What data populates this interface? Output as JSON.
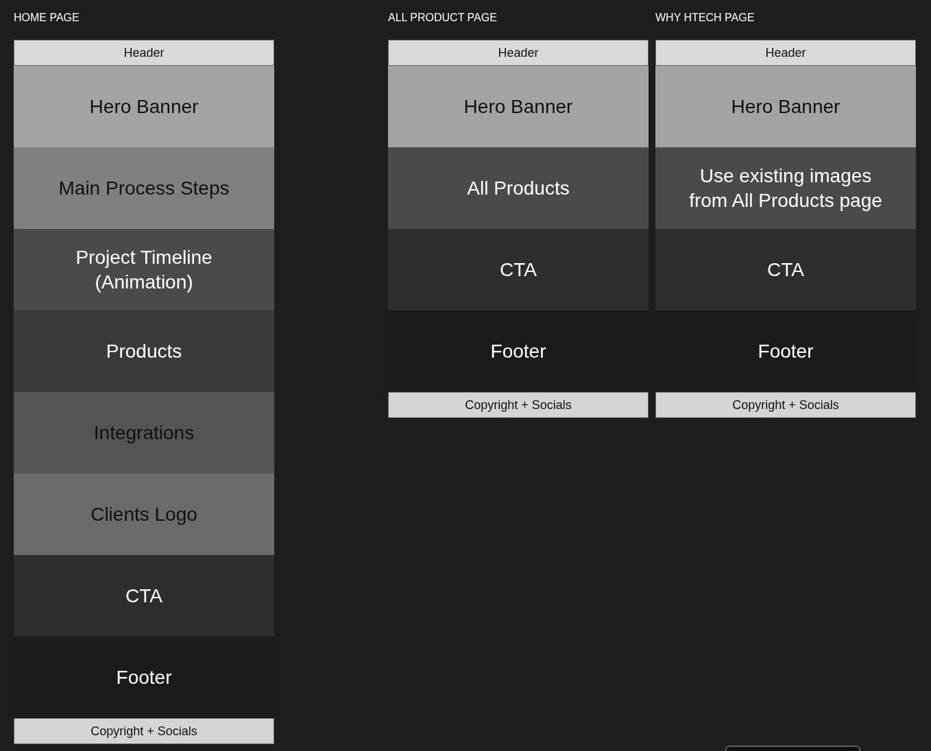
{
  "pages": [
    {
      "title": "HOME PAGE",
      "sections": [
        {
          "label": "Header",
          "kind": "bar",
          "color": "#d9d9d9",
          "dark_label": true
        },
        {
          "label": "Hero Banner",
          "kind": "block",
          "color": "#a3a3a3",
          "dark_label": true
        },
        {
          "label": "Main Process Steps",
          "kind": "block",
          "color": "#808080",
          "dark_label": true
        },
        {
          "label": "Project Timeline (Animation)",
          "kind": "block",
          "color": "#4a4a4a",
          "dark_label": false
        },
        {
          "label": "Products",
          "kind": "block",
          "color": "#3a3a3a",
          "dark_label": false
        },
        {
          "label": "Integrations",
          "kind": "block",
          "color": "#555555",
          "dark_label": true
        },
        {
          "label": "Clients Logo",
          "kind": "block",
          "color": "#6b6b6b",
          "dark_label": true
        },
        {
          "label": "CTA",
          "kind": "block",
          "color": "#2e2e2e",
          "dark_label": false
        },
        {
          "label": "Footer",
          "kind": "block",
          "color": "#1b1b1b",
          "dark_label": false
        },
        {
          "label": "Copyright + Socials",
          "kind": "bar",
          "color": "#d4d4d4",
          "dark_label": true
        }
      ]
    },
    {
      "title": "ALL PRODUCT PAGE",
      "sections": [
        {
          "label": "Header",
          "kind": "bar",
          "color": "#d9d9d9",
          "dark_label": true
        },
        {
          "label": "Hero Banner",
          "kind": "block",
          "color": "#a3a3a3",
          "dark_label": true
        },
        {
          "label": "All Products",
          "kind": "block",
          "color": "#4a4a4a",
          "dark_label": false
        },
        {
          "label": "CTA",
          "kind": "block",
          "color": "#2e2e2e",
          "dark_label": false
        },
        {
          "label": "Footer",
          "kind": "block",
          "color": "#1b1b1b",
          "dark_label": false
        },
        {
          "label": "Copyright + Socials",
          "kind": "bar",
          "color": "#d4d4d4",
          "dark_label": true
        }
      ]
    },
    {
      "title": "WHY HTECH PAGE",
      "sections": [
        {
          "label": "Header",
          "kind": "bar",
          "color": "#d9d9d9",
          "dark_label": true
        },
        {
          "label": "Hero Banner",
          "kind": "block",
          "color": "#a3a3a3",
          "dark_label": true
        },
        {
          "label": "Use existing images from All Products page",
          "kind": "block",
          "color": "#4a4a4a",
          "dark_label": false
        },
        {
          "label": "CTA",
          "kind": "block",
          "color": "#2e2e2e",
          "dark_label": false
        },
        {
          "label": "Footer",
          "kind": "block",
          "color": "#1b1b1b",
          "dark_label": false
        },
        {
          "label": "Copyright + Socials",
          "kind": "bar",
          "color": "#d4d4d4",
          "dark_label": true
        }
      ]
    }
  ]
}
